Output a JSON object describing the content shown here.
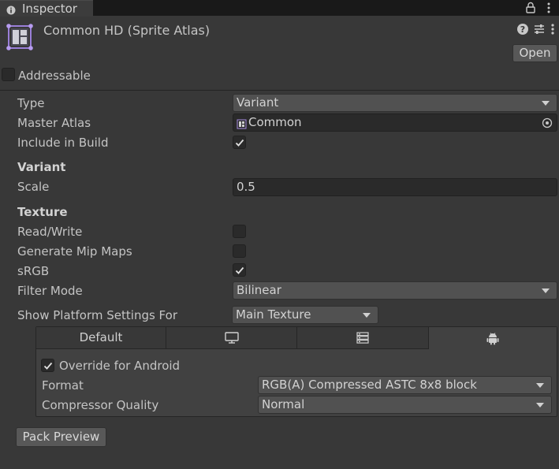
{
  "tab": {
    "label": "Inspector"
  },
  "header": {
    "title": "Common HD (Sprite Atlas)",
    "open_label": "Open"
  },
  "addressable": {
    "label": "Addressable",
    "checked": false
  },
  "fields": {
    "type": {
      "label": "Type",
      "value": "Variant"
    },
    "master_atlas": {
      "label": "Master Atlas",
      "value": "Common"
    },
    "include_in_build": {
      "label": "Include in Build",
      "checked": true
    }
  },
  "variant": {
    "heading": "Variant",
    "scale_label": "Scale",
    "scale_value": "0.5"
  },
  "texture": {
    "heading": "Texture",
    "read_write": {
      "label": "Read/Write",
      "checked": false
    },
    "generate_mip_maps": {
      "label": "Generate Mip Maps",
      "checked": false
    },
    "srgb": {
      "label": "sRGB",
      "checked": true
    },
    "filter_mode": {
      "label": "Filter Mode",
      "value": "Bilinear"
    }
  },
  "platform_settings": {
    "label": "Show Platform Settings For",
    "value": "Main Texture",
    "tabs": [
      {
        "label": "Default",
        "icon": ""
      },
      {
        "label": "",
        "icon": "monitor-icon"
      },
      {
        "label": "",
        "icon": "server-stack-icon"
      },
      {
        "label": "",
        "icon": "android-icon"
      }
    ],
    "override": {
      "label": "Override for Android",
      "checked": true
    },
    "format": {
      "label": "Format",
      "value": "RGB(A) Compressed ASTC 8x8 block"
    },
    "compressor_quality": {
      "label": "Compressor Quality",
      "value": "Normal"
    }
  },
  "pack_preview_label": "Pack Preview"
}
